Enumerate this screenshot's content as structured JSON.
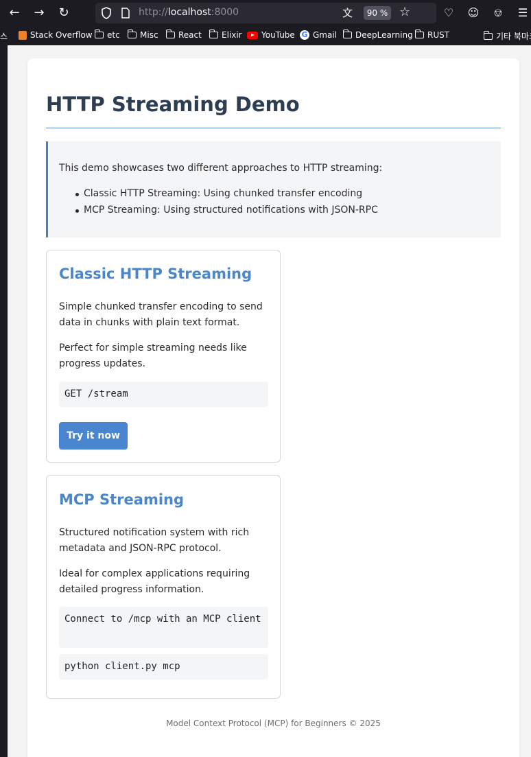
{
  "browser": {
    "url_scheme": "http://",
    "url_host": "localhost",
    "url_port": ":8000",
    "zoom": "90 %",
    "bookmarks": [
      {
        "label": "스",
        "icon": "none"
      },
      {
        "label": "Stack Overflow",
        "icon": "stackoverflow-icon"
      },
      {
        "label": "etc",
        "icon": "folder-icon"
      },
      {
        "label": "Misc",
        "icon": "folder-icon"
      },
      {
        "label": "React",
        "icon": "folder-icon"
      },
      {
        "label": "Elixir",
        "icon": "folder-icon"
      },
      {
        "label": "YouTube",
        "icon": "youtube-icon"
      },
      {
        "label": "Gmail",
        "icon": "google-icon"
      },
      {
        "label": "DeepLearning",
        "icon": "folder-icon"
      },
      {
        "label": "RUST",
        "icon": "folder-icon"
      },
      {
        "label": "기타 북마크",
        "icon": "folder-icon"
      }
    ]
  },
  "page": {
    "title": "HTTP Streaming Demo",
    "intro": {
      "text": "This demo showcases two different approaches to HTTP streaming:",
      "items": [
        "Classic HTTP Streaming: Using chunked transfer encoding",
        "MCP Streaming: Using structured notifications with JSON-RPC"
      ]
    },
    "cards": [
      {
        "title": "Classic HTTP Streaming",
        "p1": "Simple chunked transfer encoding to send data in chunks with plain text format.",
        "p2": "Perfect for simple streaming needs like progress updates.",
        "code": "GET /stream",
        "button": "Try it now"
      },
      {
        "title": "MCP Streaming",
        "p1": "Structured notification system with rich metadata and JSON-RPC protocol.",
        "p2": "Ideal for complex applications requiring detailed progress information.",
        "code1": "Connect to /mcp with an MCP client",
        "code2": "python client.py mcp"
      }
    ],
    "footer": "Model Context Protocol (MCP) for Beginners © 2025"
  },
  "colors": {
    "accent": "#4a86c8",
    "heading": "#2c3e50",
    "button": "#4a86d0"
  }
}
